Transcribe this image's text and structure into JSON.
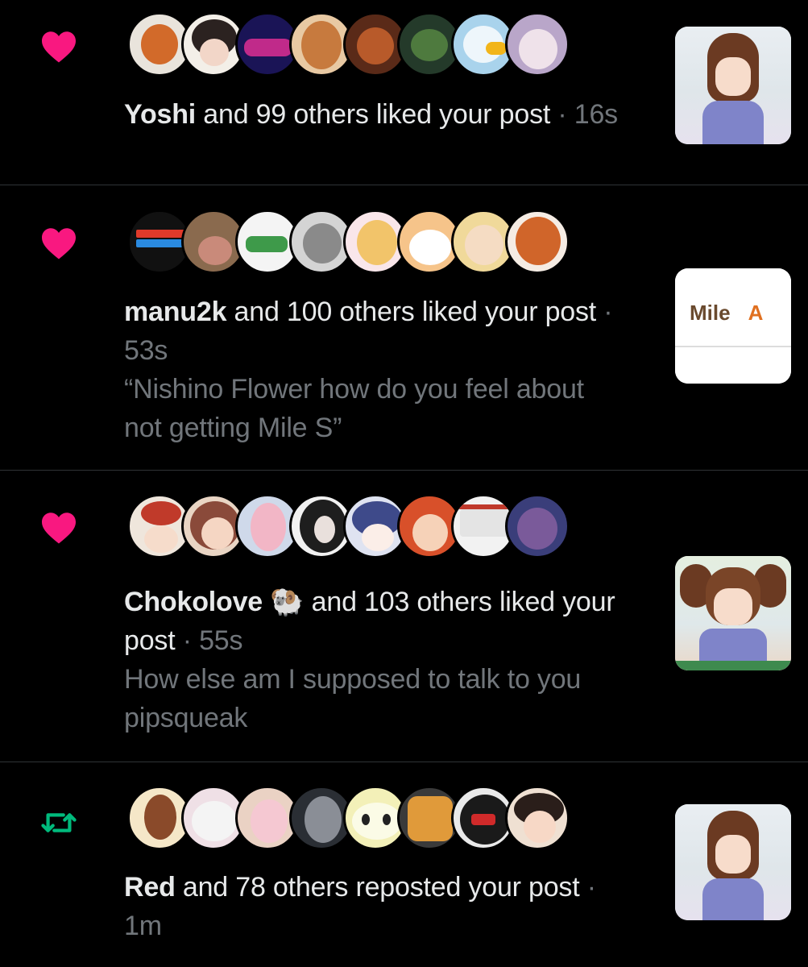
{
  "notifications": [
    {
      "type": "like",
      "icon": "heart-icon",
      "icon_color": "#f91880",
      "name": "Yoshi",
      "action": " and 99 others liked your post",
      "separator": " · ",
      "time": "16s",
      "quote": "",
      "thumbnail": "anime-girl-brown-hair-classroom"
    },
    {
      "type": "like",
      "icon": "heart-icon",
      "icon_color": "#f91880",
      "name": "manu2k",
      "action": " and 100 others liked your post",
      "separator": " · ",
      "time": "53s",
      "quote": "“Nishino Flower how do you feel about not getting Mile S”",
      "thumbnail_text": {
        "word": "Mile",
        "grade": "A"
      }
    },
    {
      "type": "like",
      "icon": "heart-icon",
      "icon_color": "#f91880",
      "name": "Chokolove",
      "name_emoji": "🐏",
      "action": " and 103 others liked your post",
      "separator": " · ",
      "time": "55s",
      "quote": "How else am I supposed to talk to you pipsqueak",
      "thumbnail": "anime-girl-pigtails-classroom"
    },
    {
      "type": "repost",
      "icon": "repost-icon",
      "icon_color": "#00ba7c",
      "name": "Red",
      "action": " and 78 others reposted your post",
      "separator": " · ",
      "time": "1m",
      "quote": "",
      "thumbnail": "anime-girl-brown-hair-classroom"
    }
  ],
  "colors": {
    "background": "#000000",
    "primary_text": "#e7e9ea",
    "secondary_text": "#71767b",
    "divider": "#2f3336",
    "like": "#f91880",
    "repost": "#00ba7c"
  }
}
